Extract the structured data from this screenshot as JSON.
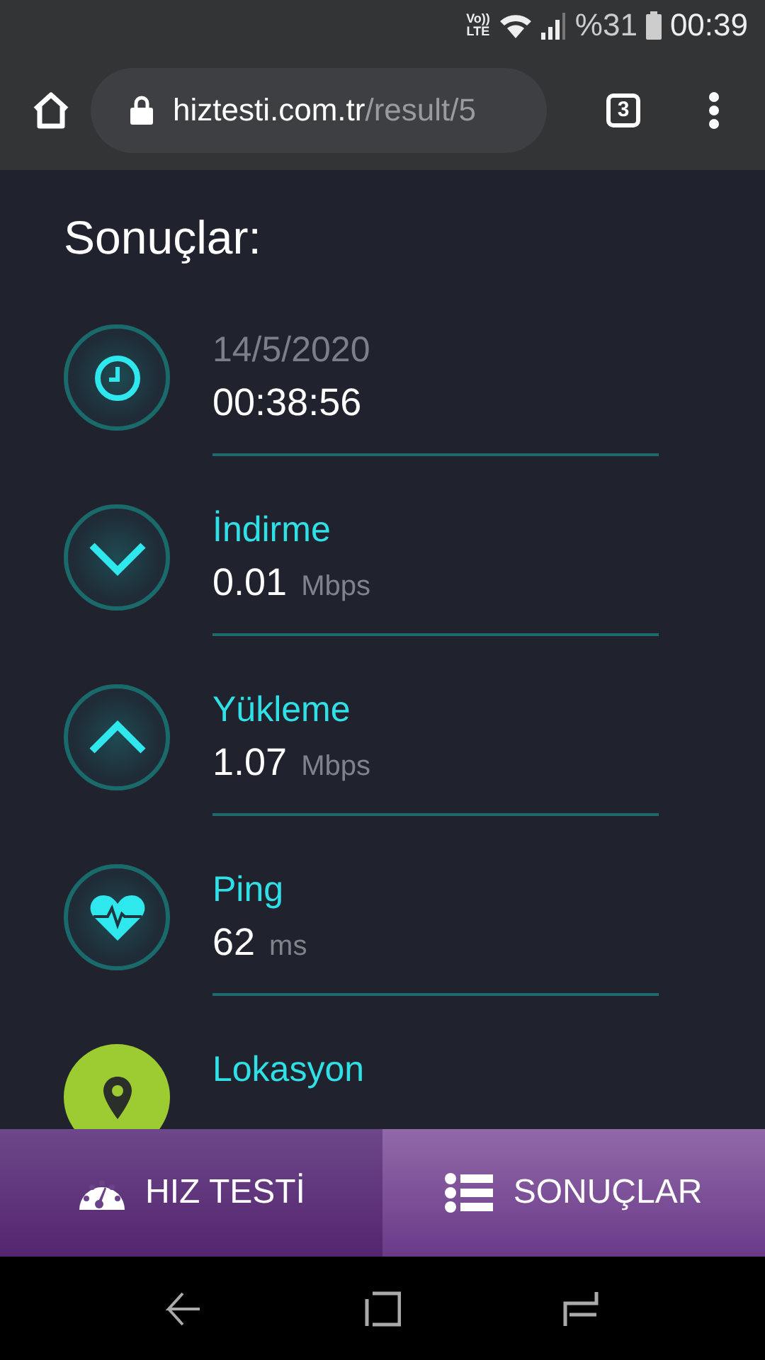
{
  "status_bar": {
    "volte": "Vo))",
    "lte": "LTE",
    "battery": "%31",
    "time": "00:39"
  },
  "browser": {
    "domain": "hiztesti.com.tr",
    "path": "/result/5",
    "tab_count": "3"
  },
  "heading": "Sonuçlar:",
  "results": [
    {
      "kind": "time",
      "label": "14/5/2020",
      "value": "00:38:56"
    },
    {
      "kind": "download",
      "label": "İndirme",
      "value": "0.01",
      "unit": "Mbps"
    },
    {
      "kind": "upload",
      "label": "Yükleme",
      "value": "1.07",
      "unit": "Mbps"
    },
    {
      "kind": "ping",
      "label": "Ping",
      "value": "62",
      "unit": "ms"
    },
    {
      "kind": "location",
      "label": "Lokasyon"
    }
  ],
  "tabs": [
    {
      "kind": "speedometer",
      "label": "HIZ TESTİ",
      "selected": false
    },
    {
      "kind": "list",
      "label": "SONUÇLAR",
      "selected": true
    }
  ]
}
